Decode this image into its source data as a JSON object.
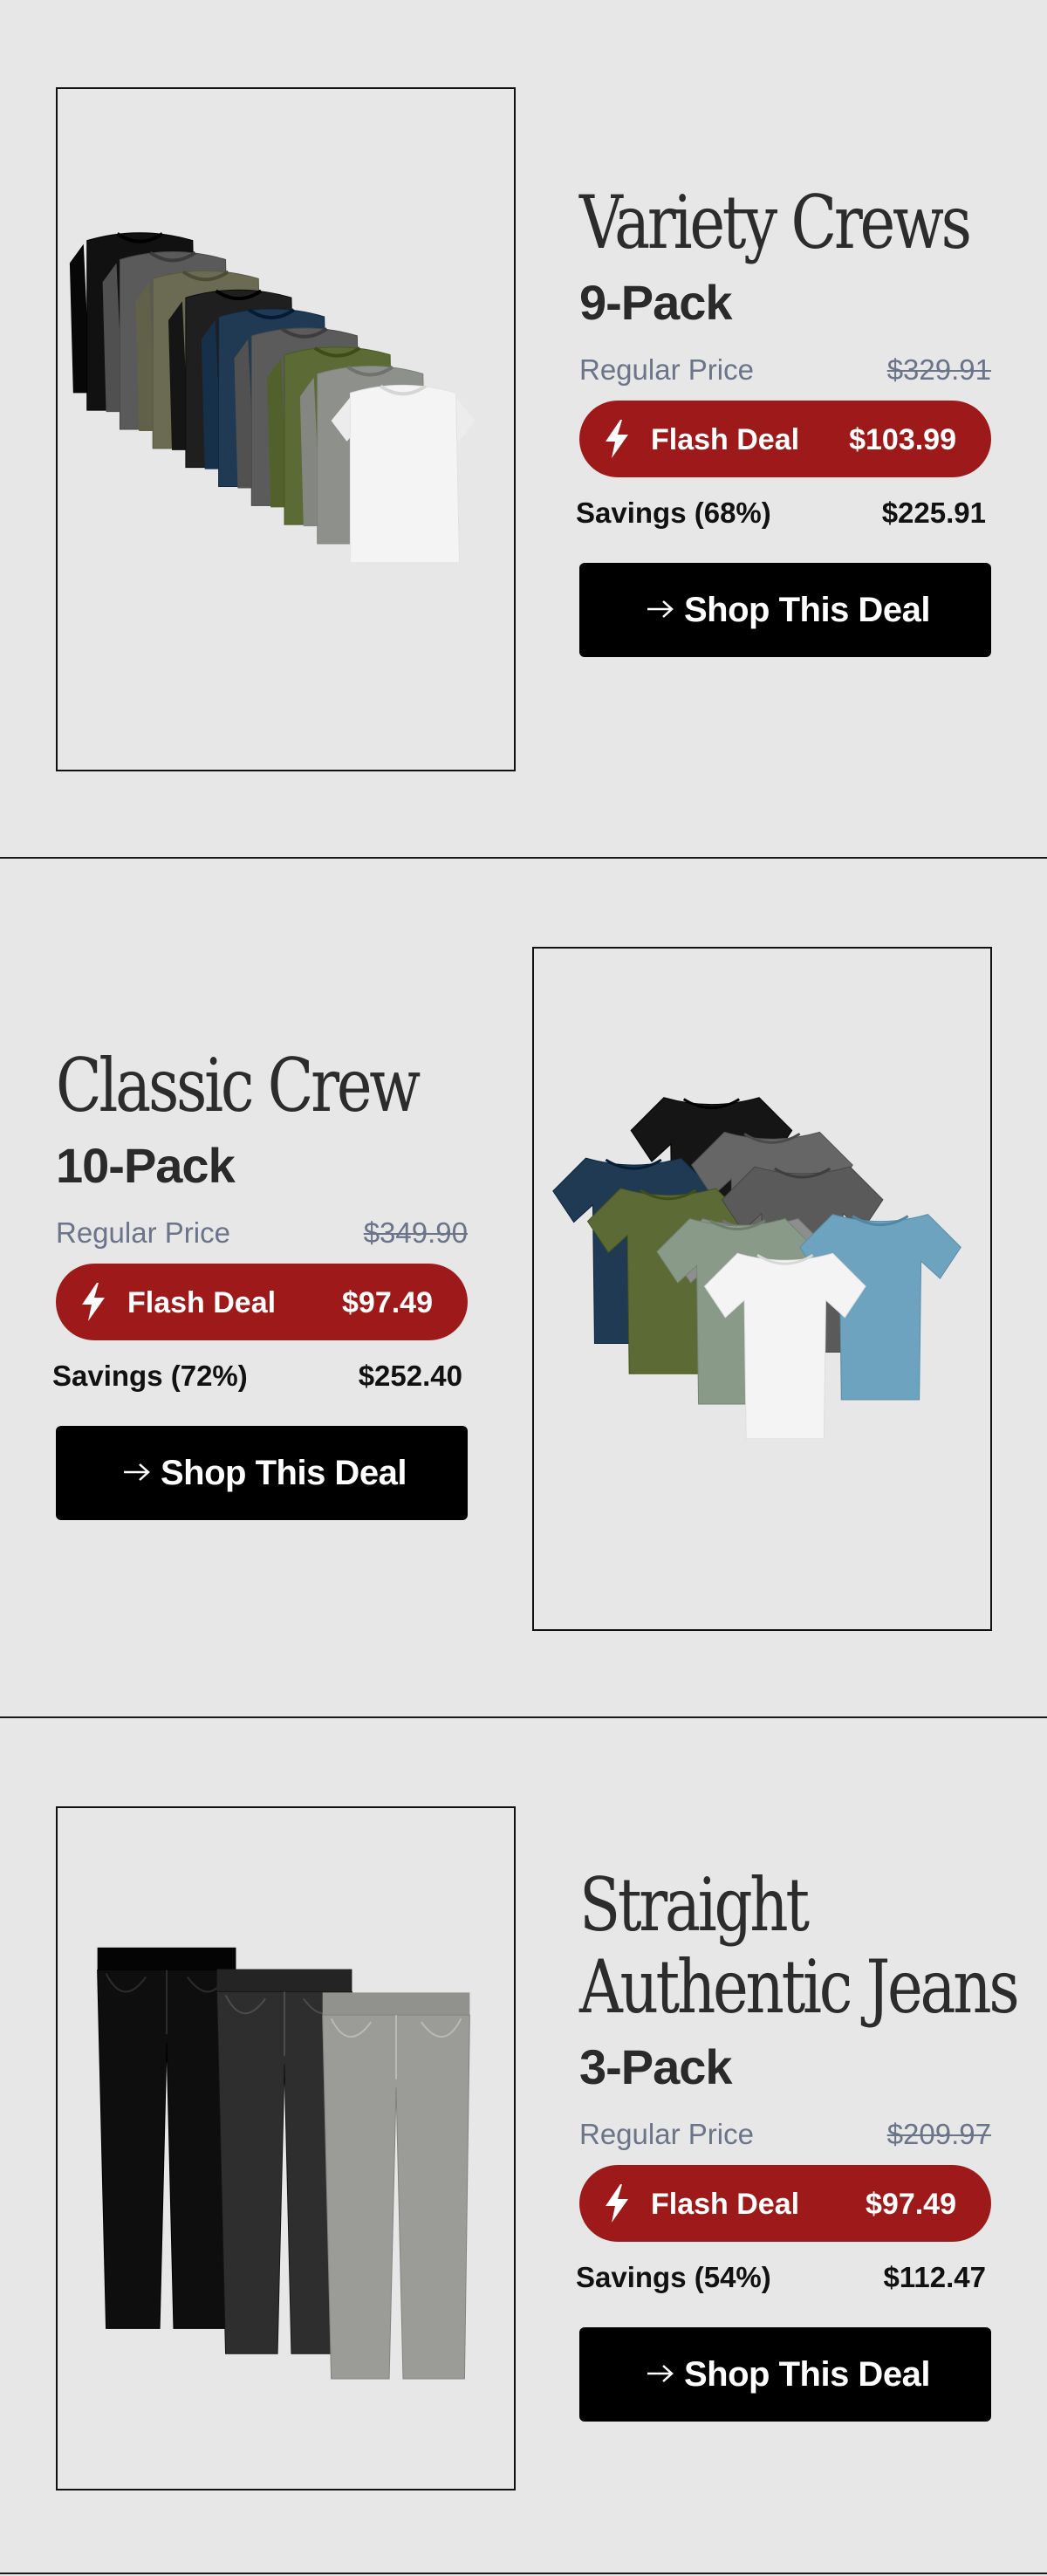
{
  "deals": [
    {
      "title_lines": [
        "Variety Crews"
      ],
      "pack": "9-Pack",
      "regular_label": "Regular Price",
      "regular_price": "$329.91",
      "flash_label": "Flash Deal",
      "flash_price": "$103.99",
      "savings_label": "Savings (68%)",
      "savings_value": "$225.91",
      "cta": "Shop This Deal",
      "image_icon": "long-sleeve-crew-stack-image",
      "image_colors": [
        "#111111",
        "#5a5a5a",
        "#6b6a52",
        "#1f1f1f",
        "#1f3a52",
        "#5b5b5b",
        "#5c6b35",
        "#8e908c",
        "#f4f4f4"
      ]
    },
    {
      "title_lines": [
        "Classic Crew"
      ],
      "pack": "10-Pack",
      "regular_label": "Regular Price",
      "regular_price": "$349.90",
      "flash_label": "Flash Deal",
      "flash_price": "$97.49",
      "savings_label": "Savings (72%)",
      "savings_value": "$252.40",
      "cta": "Shop This Deal",
      "image_icon": "crew-tee-pile-image",
      "image_colors": [
        "#151515",
        "#1f3a52",
        "#666666",
        "#5c6b35",
        "#5a5a5a",
        "#8e8e8e",
        "#8a9a88",
        "#6da3bf",
        "#f4f4f4"
      ]
    },
    {
      "title_lines": [
        "Straight",
        "Authentic Jeans"
      ],
      "pack": "3-Pack",
      "regular_label": "Regular Price",
      "regular_price": "$209.97",
      "flash_label": "Flash Deal",
      "flash_price": "$97.49",
      "savings_label": "Savings (54%)",
      "savings_value": "$112.47",
      "cta": "Shop This Deal",
      "image_icon": "jeans-trio-image",
      "image_colors": [
        "#0e0e0e",
        "#2e2e2e",
        "#9b9c98"
      ]
    }
  ],
  "colors": {
    "background": "#e7e7e7",
    "flash_red": "#9e1a1a",
    "cta_black": "#000000",
    "muted_text": "#6b7488"
  }
}
